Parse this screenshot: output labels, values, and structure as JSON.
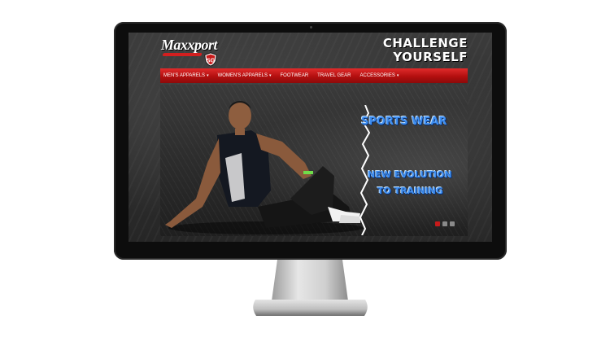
{
  "brand": {
    "logo_text": "Maxxport",
    "logo_from": "from",
    "badge_text": "SG"
  },
  "header": {
    "tagline_line1": "CHALLENGE",
    "tagline_line2": "YOURSELF"
  },
  "nav": {
    "items": [
      {
        "label": "MEN'S APPARELS",
        "dropdown": true
      },
      {
        "label": "WOMEN'S APPARELS",
        "dropdown": true
      },
      {
        "label": "FOOTWEAR",
        "dropdown": false
      },
      {
        "label": "TRAVEL GEAR",
        "dropdown": false
      },
      {
        "label": "ACCESSORIES",
        "dropdown": true
      }
    ],
    "caret": "▾"
  },
  "banner": {
    "headline_1": "SPORTS WEAR",
    "headline_2": "NEW EVOLUTION",
    "headline_3": "TO TRAINING",
    "slides_total": 3,
    "active_slide": 1
  },
  "colors": {
    "nav_red": "#c81a1a",
    "headline_blue": "#3f8ff2",
    "bezel": "#0d0d0d"
  }
}
